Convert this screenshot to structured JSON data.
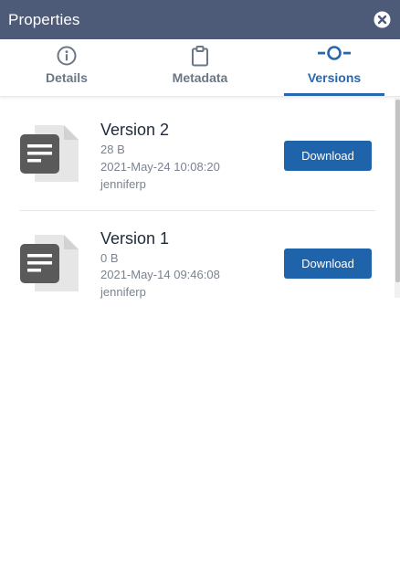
{
  "window": {
    "title": "Properties",
    "close_icon": "close-icon"
  },
  "tabs": [
    {
      "label": "Details",
      "icon": "info-icon",
      "active": false
    },
    {
      "label": "Metadata",
      "icon": "clipboard-icon",
      "active": false
    },
    {
      "label": "Versions",
      "icon": "version-history-icon",
      "active": true
    }
  ],
  "versions": [
    {
      "name": "Version 2",
      "size": "28 B",
      "date": "2021-May-24 10:08:20",
      "user": "jenniferp",
      "action": "Download",
      "icon": "text-file-icon"
    },
    {
      "name": "Version 1",
      "size": "0 B",
      "date": "2021-May-14 09:46:08",
      "user": "jenniferp",
      "action": "Download",
      "icon": "text-file-icon"
    }
  ],
  "colors": {
    "titlebar": "#4e5b78",
    "accent": "#2867b0",
    "button": "#1f63aa",
    "inactive_tab": "#6b7787"
  }
}
